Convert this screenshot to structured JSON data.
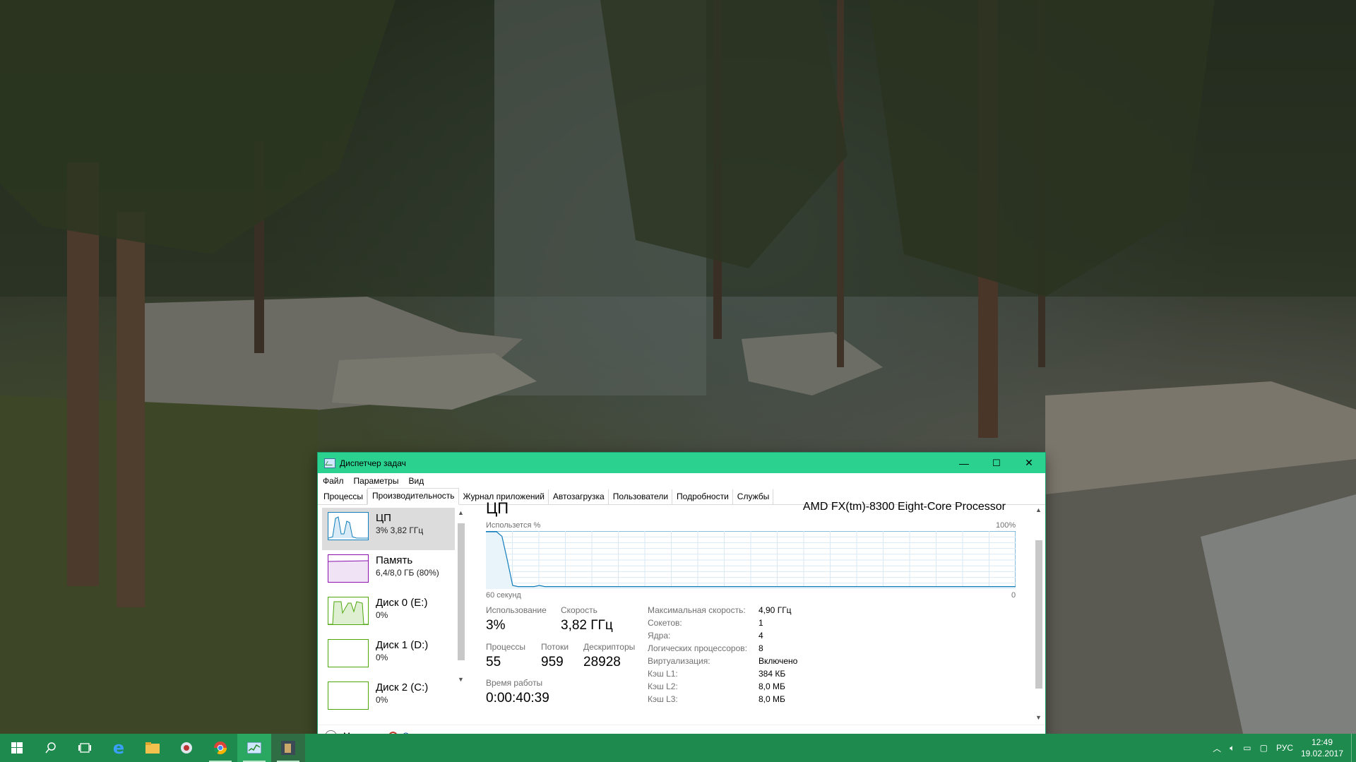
{
  "window": {
    "title": "Диспетчер задач",
    "minimize_glyph": "—",
    "maximize_glyph": "☐",
    "close_glyph": "✕"
  },
  "menu": [
    "Файл",
    "Параметры",
    "Вид"
  ],
  "tabs": [
    "Процессы",
    "Производительность",
    "Журнал приложений",
    "Автозагрузка",
    "Пользователи",
    "Подробности",
    "Службы"
  ],
  "active_tab": "Производительность",
  "sidebar": [
    {
      "title": "ЦП",
      "subtitle": "3% 3,82 ГГц",
      "color": "#117dbb"
    },
    {
      "title": "Память",
      "subtitle": "6,4/8,0 ГБ (80%)",
      "color": "#8b12ae"
    },
    {
      "title": "Диск 0 (E:)",
      "subtitle": "0%",
      "color": "#4da60c"
    },
    {
      "title": "Диск 1 (D:)",
      "subtitle": "0%",
      "color": "#4da60c"
    },
    {
      "title": "Диск 2 (C:)",
      "subtitle": "0%",
      "color": "#4da60c"
    }
  ],
  "cpu": {
    "heading": "ЦП",
    "model": "AMD FX(tm)-8300 Eight-Core Processor",
    "graph_label": "Использется %",
    "graph_max": "100%",
    "graph_time": "60 секунд",
    "graph_min": "0",
    "usage_label": "Использование",
    "usage_value": "3%",
    "speed_label": "Скорость",
    "speed_value": "3,82 ГГц",
    "processes_label": "Процессы",
    "processes_value": "55",
    "threads_label": "Потоки",
    "threads_value": "959",
    "handles_label": "Дескрипторы",
    "handles_value": "28928",
    "uptime_label": "Время работы",
    "uptime_value": "0:00:40:39",
    "specs": [
      {
        "key": "Максимальная скорость:",
        "value": "4,90 ГГц"
      },
      {
        "key": "Сокетов:",
        "value": "1"
      },
      {
        "key": "Ядра:",
        "value": "4"
      },
      {
        "key": "Логических процессоров:",
        "value": "8"
      },
      {
        "key": "Виртуализация:",
        "value": "Включено"
      },
      {
        "key": "Кэш L1:",
        "value": "384 КБ"
      },
      {
        "key": "Кэш L2:",
        "value": "8,0 МБ"
      },
      {
        "key": "Кэш L3:",
        "value": "8,0 МБ"
      }
    ],
    "history_percent": [
      100,
      100,
      100,
      92,
      50,
      5,
      3,
      3,
      3,
      3,
      5,
      3,
      3,
      3,
      3,
      3,
      3,
      3,
      3,
      3,
      3,
      3,
      3,
      3,
      3,
      3,
      3,
      3,
      3,
      3,
      3,
      3,
      3,
      3,
      3,
      3,
      3,
      3,
      3,
      3,
      3,
      3,
      3,
      3,
      3,
      3,
      3,
      3,
      3,
      3,
      3,
      3,
      3,
      3,
      3,
      3,
      3,
      3,
      3,
      3,
      3,
      3,
      3,
      3,
      3,
      3,
      3,
      3,
      3,
      3,
      3,
      3,
      3,
      3,
      3,
      3,
      3,
      3,
      3,
      3,
      3,
      3,
      3,
      3,
      3,
      3,
      3,
      3,
      3,
      3,
      3,
      3,
      3,
      3,
      3,
      3,
      3,
      3,
      3,
      3
    ]
  },
  "footer": {
    "less_label": "Меньше",
    "monitor_label": "Открыть монитор ресурсов"
  },
  "taskbar": {
    "language": "РУС",
    "time": "12:49",
    "date": "19.02.2017"
  },
  "colors": {
    "title_bar": "#2bd28f",
    "taskbar": "#1e8a4e",
    "cpu_line": "#117dbb"
  }
}
